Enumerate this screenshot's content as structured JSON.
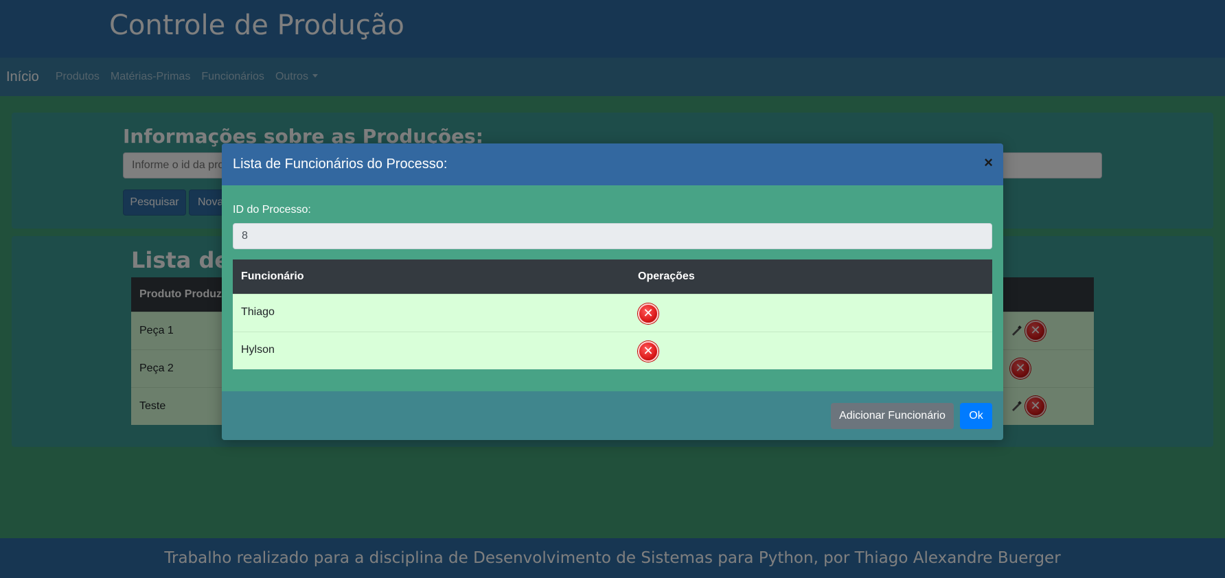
{
  "site": {
    "title": "Controle de Produção"
  },
  "navbar": {
    "brand": "Início",
    "links": [
      "Produtos",
      "Matérias-Primas",
      "Funcionários",
      "Outros"
    ]
  },
  "info_card": {
    "title": "Informações sobre as Produções:",
    "search_placeholder": "Informe o id da pro",
    "search_button": "Pesquisar",
    "new_button": "Nova"
  },
  "list_card": {
    "title": "Lista de P",
    "header": "Produto Produz",
    "rows": [
      "Peça 1",
      "Peça 2",
      "Teste"
    ]
  },
  "modal": {
    "title": "Lista de Funcionários do Processo:",
    "close_symbol": "×",
    "process_id_label": "ID do Processo:",
    "process_id_value": "8",
    "table": {
      "columns": [
        "Funcionário",
        "Operações"
      ],
      "rows": [
        {
          "name": "Thiago"
        },
        {
          "name": "Hylson"
        }
      ]
    },
    "add_button": "Adicionar Funcionário",
    "ok_button": "Ok"
  },
  "footer": {
    "text": "Trabalho realizado para a disciplina de Desenvolvimento de Sistemas para Python, por Thiago Alexandre Buerger"
  },
  "colors": {
    "primary": "#2f6da4",
    "success_row": "#d9ffd9",
    "ok_button": "#007bff",
    "secondary_button": "#6c757d",
    "delete_icon": "#e02020"
  },
  "icons": {
    "delete": "delete-circle-icon",
    "close": "close-icon",
    "edit": "edit-icon"
  }
}
